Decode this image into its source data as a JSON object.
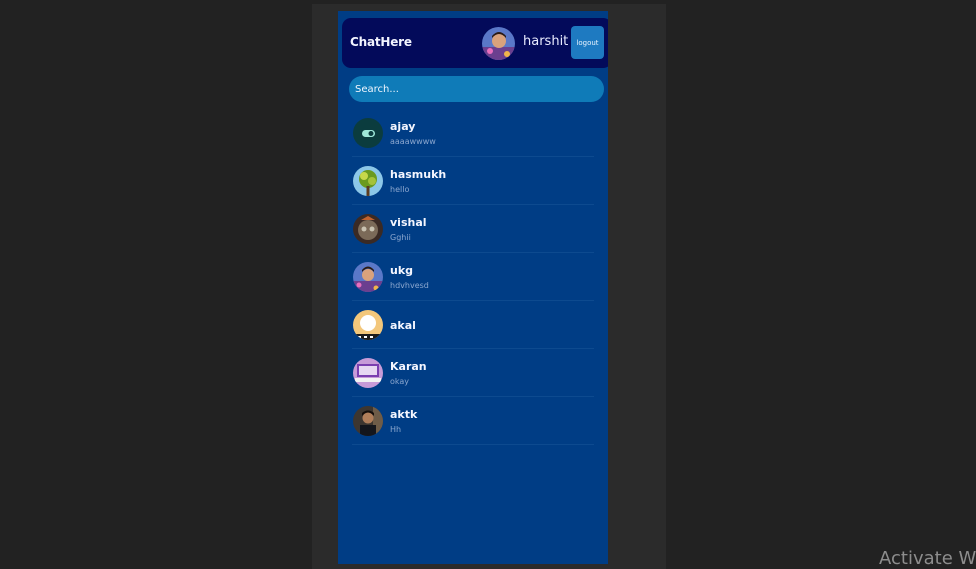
{
  "header": {
    "brand": "ChatHere",
    "user_name": "harshit",
    "logout_label": "logout"
  },
  "search": {
    "placeholder": "Search..."
  },
  "chats": [
    {
      "name": "ajay",
      "last_message": "aaaawwww",
      "avatar": "dark-teal-toggle-avatar"
    },
    {
      "name": "hasmukh",
      "last_message": "hello",
      "avatar": "tree-avatar"
    },
    {
      "name": "vishal",
      "last_message": "Gghii",
      "avatar": "mask-avatar"
    },
    {
      "name": "ukg",
      "last_message": "hdvhvesd",
      "avatar": "selfie-avatar"
    },
    {
      "name": "akal",
      "last_message": "",
      "avatar": "orange-logo-avatar"
    },
    {
      "name": "Karan",
      "last_message": "okay",
      "avatar": "purple-laptop-avatar"
    },
    {
      "name": "aktk",
      "last_message": "Hh",
      "avatar": "man-avatar"
    }
  ],
  "watermark": "Activate W",
  "colors": {
    "page_bg": "#222222",
    "phone_bg": "#003d85",
    "header_bg": "#030a5a",
    "search_bg": "#0f7bb8",
    "logout_bg": "#1e7ac1"
  }
}
